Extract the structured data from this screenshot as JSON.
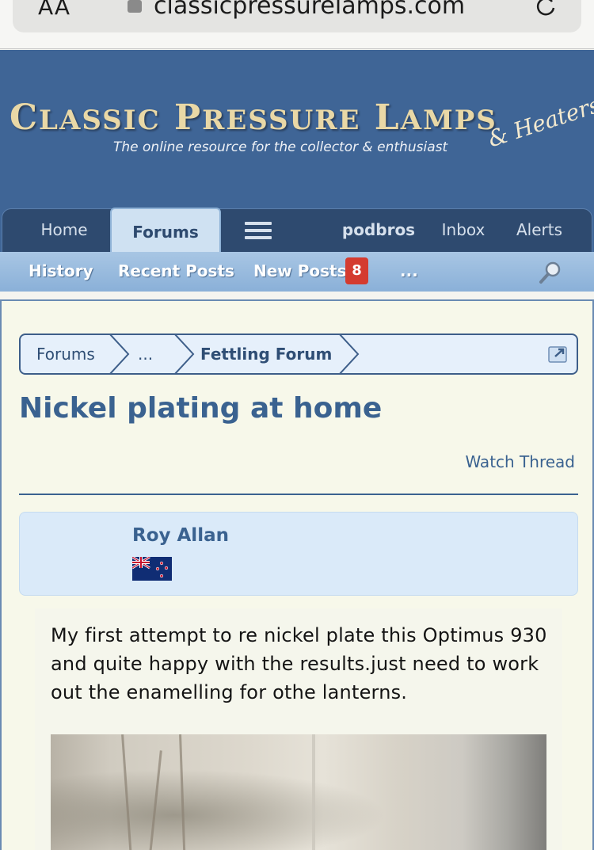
{
  "browser": {
    "aa_label": "AA",
    "url": "classicpressurelamps.com"
  },
  "site": {
    "logo_title": "Classic Pressure Lamps",
    "logo_tagline": "The online resource for the collector & enthusiast",
    "logo_script": "& Heaters",
    "accent": "#3f6596"
  },
  "nav": {
    "home": "Home",
    "forums": "Forums",
    "user": "podbros",
    "inbox": "Inbox",
    "alerts": "Alerts"
  },
  "subnav": {
    "history": "History",
    "recent_posts": "Recent Posts",
    "new_posts": "New Posts",
    "new_posts_count": "8",
    "more": "..."
  },
  "breadcrumb": {
    "forums": "Forums",
    "ellipsis": "...",
    "current": "Fettling Forum"
  },
  "thread": {
    "title": "Nickel plating at home",
    "watch_label": "Watch Thread"
  },
  "post": {
    "author": "Roy Allan",
    "flag": "new-zealand-flag",
    "body": "My first attempt to re nickel plate this Optimus 930 and quite happy with the results.just need to work out the enamelling for othe lanterns."
  }
}
